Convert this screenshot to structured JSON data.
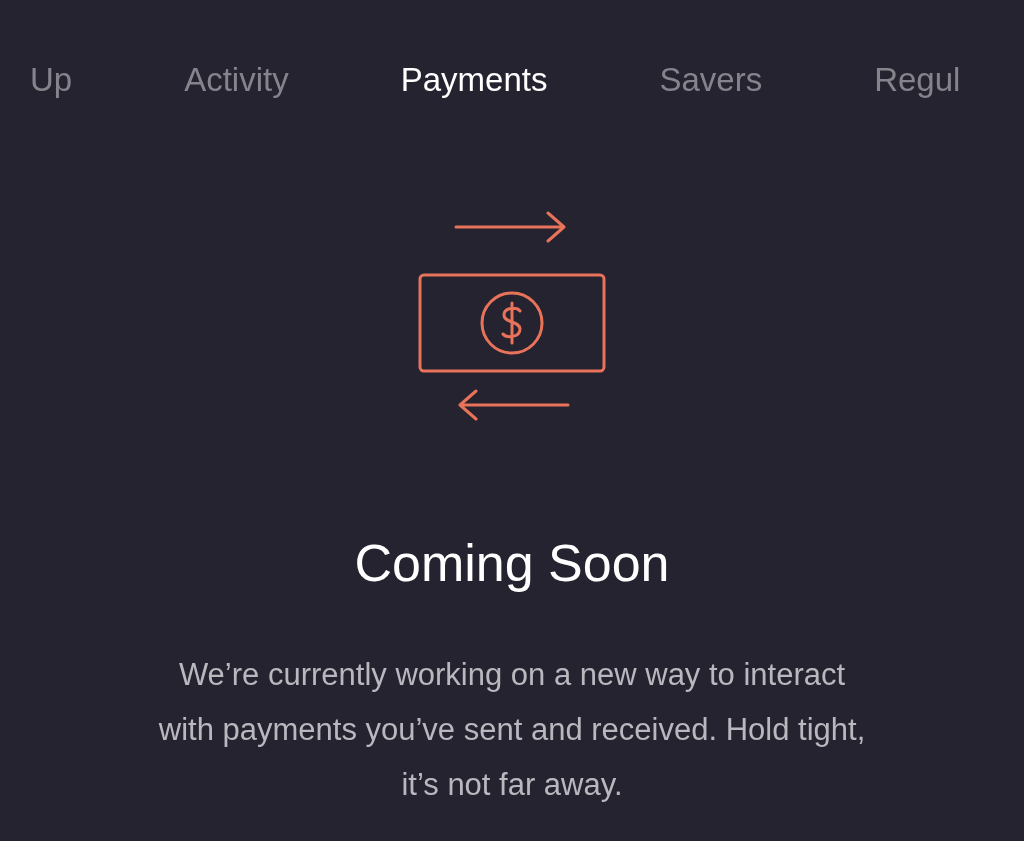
{
  "tabs": [
    {
      "label": "Up",
      "selected": false
    },
    {
      "label": "Activity",
      "selected": false
    },
    {
      "label": "Payments",
      "selected": true
    },
    {
      "label": "Savers",
      "selected": false
    },
    {
      "label": "Regul",
      "selected": false
    }
  ],
  "empty_state": {
    "title": "Coming Soon",
    "message": "We’re currently working on a new way to interact with payments you’ve sent and received. Hold tight, it’s not far away."
  }
}
